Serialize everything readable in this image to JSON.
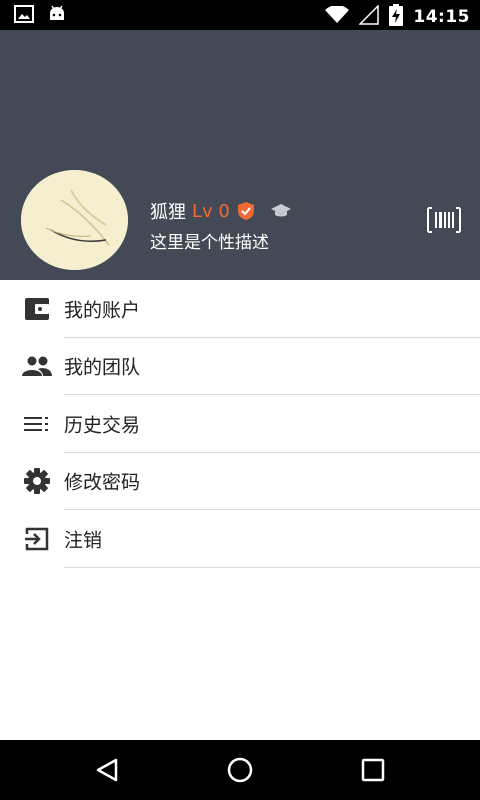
{
  "status_bar": {
    "time": "14:15",
    "left_icons": [
      "image-icon",
      "android-icon"
    ],
    "right_icons": [
      "wifi-icon",
      "signal-icon",
      "battery-charging-icon"
    ]
  },
  "header": {
    "background_color": "#434a55",
    "user": {
      "name": "狐狸",
      "level": "Lv 0",
      "signature": "这里是个性描述"
    },
    "icons": [
      "verified-badge-icon",
      "graduation-cap-icon",
      "barcode-icon"
    ]
  },
  "menu": {
    "items": [
      {
        "label": "我的账户",
        "icon": "wallet-icon"
      },
      {
        "label": "我的团队",
        "icon": "people-icon"
      },
      {
        "label": "历史交易",
        "icon": "list-icon"
      },
      {
        "label": "修改密码",
        "icon": "settings-gear-icon"
      },
      {
        "label": "注销",
        "icon": "logout-icon"
      }
    ]
  },
  "nav_bar": {
    "buttons": [
      "back-button",
      "home-button",
      "recents-button"
    ]
  },
  "colors": {
    "accent": "#f06a35",
    "header": "#434a55",
    "icon": "#333333"
  }
}
